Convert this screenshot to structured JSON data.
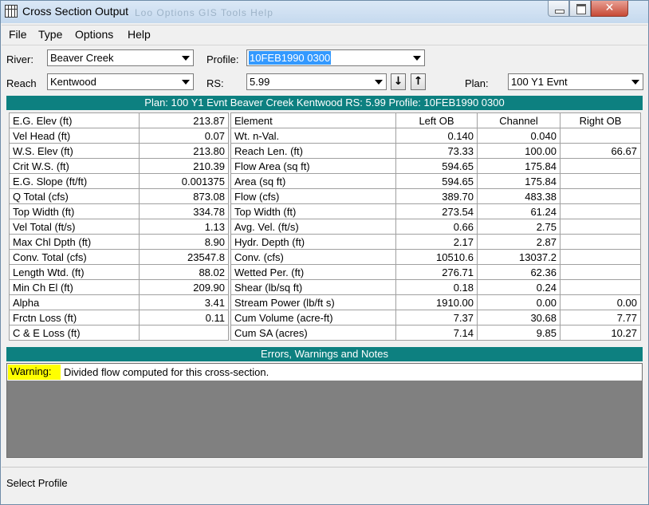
{
  "window": {
    "title": "Cross Section Output",
    "background_menu": "Loo  Options  GIS Tools  Help"
  },
  "menu": [
    "File",
    "Type",
    "Options",
    "Help"
  ],
  "fields": {
    "river_label": "River:",
    "river_value": "Beaver Creek",
    "reach_label": "Reach",
    "reach_value": "Kentwood",
    "profile_label": "Profile:",
    "profile_value": "10FEB1990 0300",
    "rs_label": "RS:",
    "rs_value": "5.99",
    "plan_label": "Plan:",
    "plan_value": "100 Y1 Evnt"
  },
  "header_bar": "Plan: 100 Y1 Evnt   Beaver Creek   Kentwood  RS: 5.99   Profile: 10FEB1990 0300",
  "left_table": [
    [
      "E.G. Elev (ft)",
      "213.87"
    ],
    [
      "Vel Head (ft)",
      "0.07"
    ],
    [
      "W.S. Elev (ft)",
      "213.80"
    ],
    [
      "Crit W.S. (ft)",
      "210.39"
    ],
    [
      "E.G. Slope (ft/ft)",
      "0.001375"
    ],
    [
      "Q Total (cfs)",
      "873.08"
    ],
    [
      "Top Width (ft)",
      "334.78"
    ],
    [
      "Vel Total (ft/s)",
      "1.13"
    ],
    [
      "Max Chl Dpth (ft)",
      "8.90"
    ],
    [
      "Conv. Total (cfs)",
      "23547.8"
    ],
    [
      "Length Wtd. (ft)",
      "88.02"
    ],
    [
      "Min Ch El (ft)",
      "209.90"
    ],
    [
      "Alpha",
      "3.41"
    ],
    [
      "Frctn Loss (ft)",
      "0.11"
    ],
    [
      "C & E Loss (ft)",
      ""
    ]
  ],
  "right_table": {
    "headers": [
      "Element",
      "Left OB",
      "Channel",
      "Right OB"
    ],
    "rows": [
      [
        "Wt. n-Val.",
        "0.140",
        "0.040",
        ""
      ],
      [
        "Reach Len. (ft)",
        "73.33",
        "100.00",
        "66.67"
      ],
      [
        "Flow Area (sq ft)",
        "594.65",
        "175.84",
        ""
      ],
      [
        "Area (sq ft)",
        "594.65",
        "175.84",
        ""
      ],
      [
        "Flow (cfs)",
        "389.70",
        "483.38",
        ""
      ],
      [
        "Top Width (ft)",
        "273.54",
        "61.24",
        ""
      ],
      [
        "Avg. Vel. (ft/s)",
        "0.66",
        "2.75",
        ""
      ],
      [
        "Hydr. Depth (ft)",
        "2.17",
        "2.87",
        ""
      ],
      [
        "Conv. (cfs)",
        "10510.6",
        "13037.2",
        ""
      ],
      [
        "Wetted Per. (ft)",
        "276.71",
        "62.36",
        ""
      ],
      [
        "Shear (lb/sq ft)",
        "0.18",
        "0.24",
        ""
      ],
      [
        "Stream Power (lb/ft s)",
        "1910.00",
        "0.00",
        "0.00"
      ],
      [
        "Cum Volume (acre-ft)",
        "7.37",
        "30.68",
        "7.77"
      ],
      [
        "Cum SA (acres)",
        "7.14",
        "9.85",
        "10.27"
      ]
    ]
  },
  "messages": {
    "title": "Errors, Warnings and Notes",
    "warning_label": "Warning:",
    "warning_text": "Divided flow computed for this cross-section."
  },
  "status_text": "Select Profile",
  "colors": {
    "teal": "#0d8080",
    "warning": "#ffff00",
    "selection": "#3399ff"
  }
}
